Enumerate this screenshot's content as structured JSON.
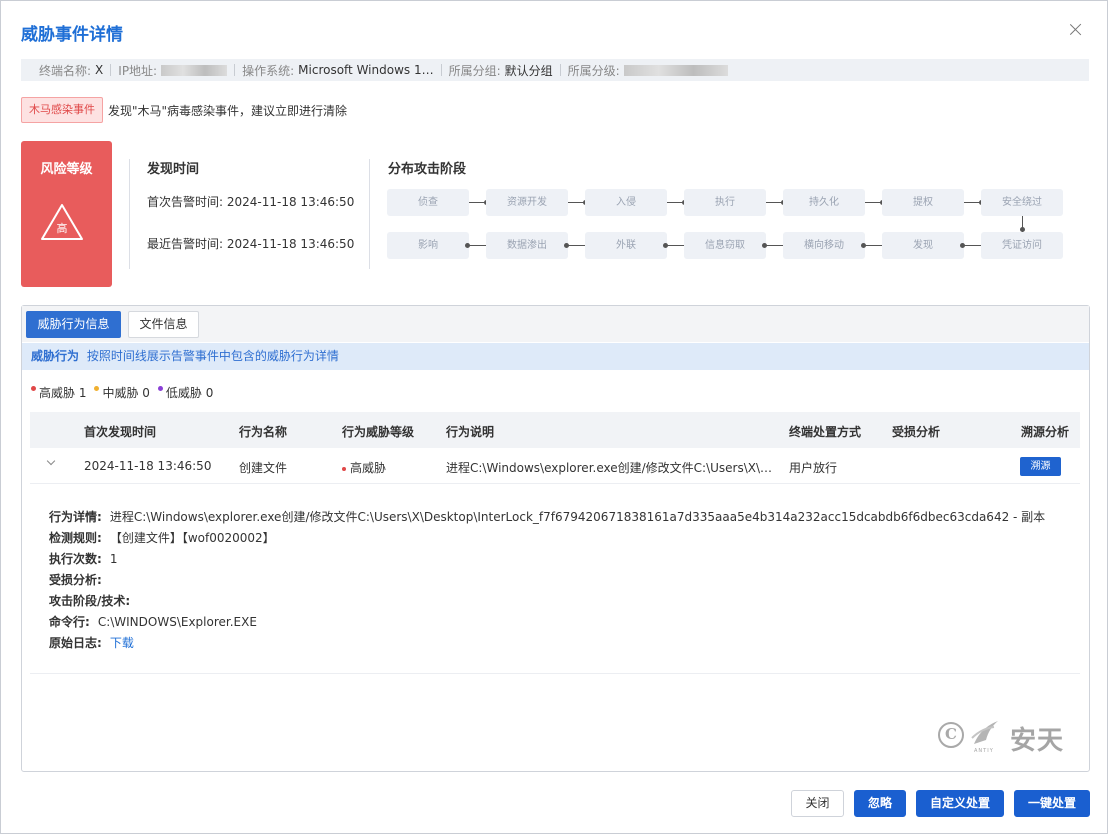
{
  "dialog": {
    "title": "威胁事件详情"
  },
  "info_bar": {
    "terminal_name_key": "终端名称:",
    "terminal_name_val": "X",
    "ip_key": "IP地址:",
    "os_key": "操作系统:",
    "os_val": "Microsoft Windows 1…",
    "group_key": "所属分组:",
    "group_val": "默认分组",
    "level_key": "所属分级:"
  },
  "alert": {
    "tag": "木马感染事件",
    "message": "发现\"木马\"病毒感染事件，建议立即进行清除"
  },
  "risk": {
    "title": "风险等级",
    "level": "高",
    "color": "#e85c5c"
  },
  "discovery": {
    "title": "发现时间",
    "first_label": "首次告警时间:",
    "first_value": "2024-11-18 13:46:50",
    "last_label": "最近告警时间:",
    "last_value": "2024-11-18 13:46:50"
  },
  "attack_stages": {
    "title": "分布攻击阶段",
    "row1": [
      "侦查",
      "资源开发",
      "入侵",
      "执行",
      "持久化",
      "提权",
      "安全绕过"
    ],
    "row2": [
      "影响",
      "数据渗出",
      "外联",
      "信息窃取",
      "横向移动",
      "发现",
      "凭证访问"
    ]
  },
  "tabs": {
    "active": "威胁行为信息",
    "inactive": "文件信息"
  },
  "hint": {
    "title": "威胁行为",
    "text": "按照时间线展示告警事件中包含的威胁行为详情"
  },
  "legend": {
    "high": "高威胁 1",
    "mid": "中威胁 0",
    "low": "低威胁 0",
    "high_color": "#e04848",
    "mid_color": "#f0b030",
    "low_color": "#8a3fd6"
  },
  "table": {
    "headers": {
      "first_time": "首次发现时间",
      "name": "行为名称",
      "severity": "行为威胁等级",
      "desc": "行为说明",
      "action": "终端处置方式",
      "damage": "受损分析",
      "trace": "溯源分析"
    },
    "row": {
      "first_time": "2024-11-18 13:46:50",
      "name": "创建文件",
      "severity": "高威胁",
      "desc": "进程C:\\Windows\\explorer.exe创建/修改文件C:\\Users\\X\\…",
      "action": "用户放行",
      "trace_button": "溯源"
    }
  },
  "detail": {
    "behavior_key": "行为详情:",
    "behavior_val": "进程C:\\Windows\\explorer.exe创建/修改文件C:\\Users\\X\\Desktop\\InterLock_f7f679420671838161a7d335aaa5e4b314a232acc15dcabdb6f6dbec63cda642 - 副本",
    "rule_key": "检测规则:",
    "rule_val": "【创建文件】【wof0020002】",
    "count_key": "执行次数:",
    "count_val": "1",
    "damage_key": "受损分析:",
    "stage_key": "攻击阶段/技术:",
    "cmd_key": "命令行:",
    "cmd_val": "C:\\WINDOWS\\Explorer.EXE",
    "log_key": "原始日志:",
    "log_link": "下载"
  },
  "watermark": {
    "symbol": "C",
    "brand": "安天",
    "sub": "ANTIY"
  },
  "footer": {
    "close": "关闭",
    "ignore": "忽略",
    "custom": "自定义处置",
    "one_click": "一键处置"
  },
  "colors": {
    "accent": "#1f6fd6",
    "danger": "#e85c5c",
    "button": "#1a5fd0"
  }
}
